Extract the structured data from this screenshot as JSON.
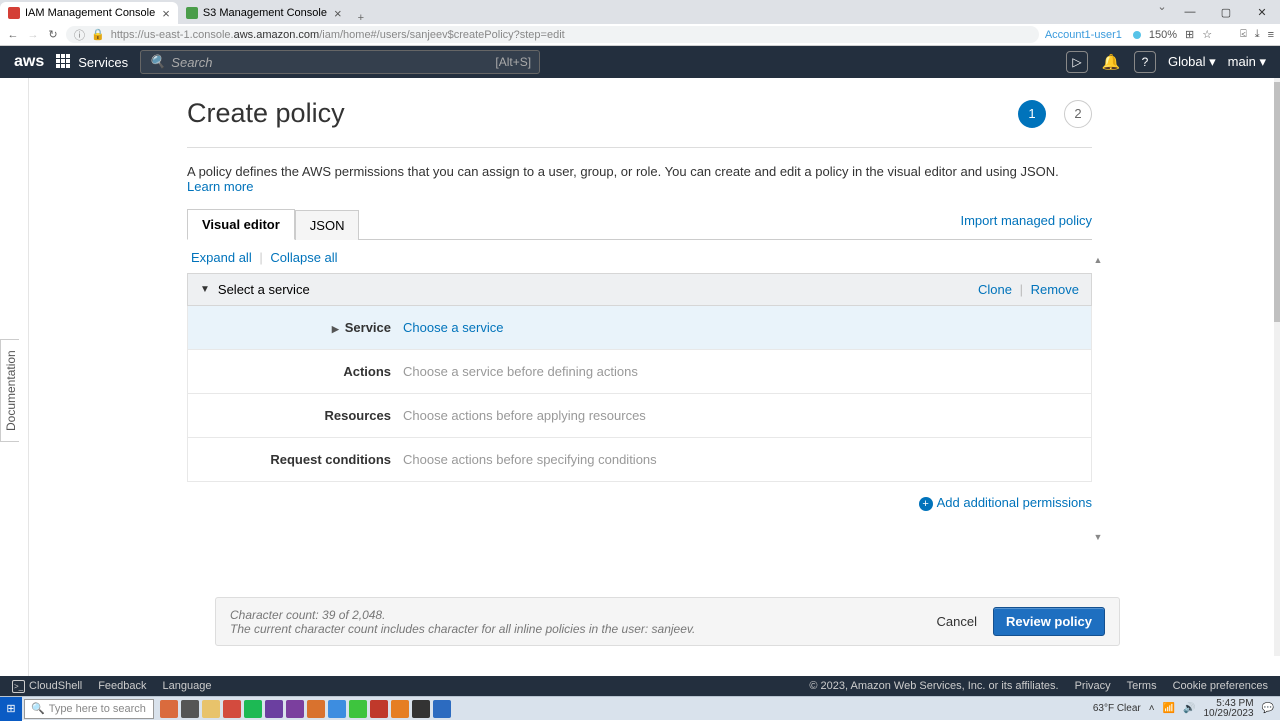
{
  "browser": {
    "tabs": [
      {
        "title": "IAM Management Console",
        "favcolor": "#d43f36"
      },
      {
        "title": "S3 Management Console",
        "favcolor": "#4a9d4a"
      }
    ],
    "url_prefix": "https://us-east-1.console.",
    "url_bold": "aws.amazon.com",
    "url_suffix": "/iam/home#/users/sanjeev$createPolicy?step=edit",
    "account": "Account1-user1",
    "zoom": "150%"
  },
  "aws_header": {
    "services": "Services",
    "search_placeholder": "Search",
    "kbd": "[Alt+S]",
    "region": "Global",
    "user": "main"
  },
  "page": {
    "title": "Create policy",
    "steps": [
      "1",
      "2"
    ],
    "desc": "A policy defines the AWS permissions that you can assign to a user, group, or role. You can create and edit a policy in the visual editor and using JSON. ",
    "learn_more": "Learn more",
    "tabs": {
      "visual": "Visual editor",
      "json": "JSON"
    },
    "import": "Import managed policy",
    "expand": "Expand all",
    "collapse": "Collapse all",
    "section_title": "Select a service",
    "clone": "Clone",
    "remove": "Remove",
    "rows": {
      "service_label": "Service",
      "service_value": "Choose a service",
      "actions_label": "Actions",
      "actions_value": "Choose a service before defining actions",
      "resources_label": "Resources",
      "resources_value": "Choose actions before applying resources",
      "conditions_label": "Request conditions",
      "conditions_value": "Choose actions before specifying conditions"
    },
    "add_perm": "Add additional permissions",
    "char_count": "Character count: 39 of 2,048.",
    "char_note": "The current character count includes character for all inline policies in the user: sanjeev.",
    "cancel": "Cancel",
    "review": "Review policy",
    "doc_tab": "Documentation"
  },
  "footer": {
    "cloudshell": "CloudShell",
    "feedback": "Feedback",
    "language": "Language",
    "copyright": "© 2023, Amazon Web Services, Inc. or its affiliates.",
    "privacy": "Privacy",
    "terms": "Terms",
    "cookie": "Cookie preferences"
  },
  "taskbar": {
    "search": "Type here to search",
    "weather": "63°F  Clear",
    "time": "5:43 PM",
    "date": "10/29/2023"
  }
}
